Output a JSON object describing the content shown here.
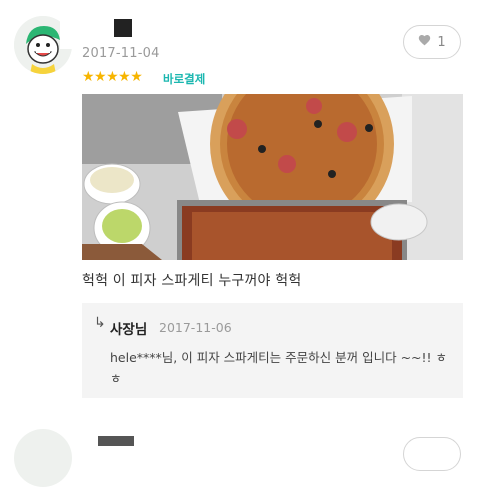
{
  "review": {
    "date": "2017-11-04",
    "rating": 5,
    "stars": "★★★★★",
    "pay_tag": "바로결제",
    "likes": "1",
    "text": "헉헉 이 피자 스파게티 누구꺼야 헉헉"
  },
  "reply": {
    "author": "사장님",
    "date": "2017-11-06",
    "text": "hele****님, 이 피자 스파게티는 주문하신 분꺼 입니다 ~~!! ㅎㅎ"
  },
  "icons": {
    "like": "heart-icon",
    "reply": "reply-arrow-icon"
  },
  "colors": {
    "star": "#f7b500",
    "pay_tag": "#1bb7b0",
    "reply_bg": "#f4f4f4"
  }
}
